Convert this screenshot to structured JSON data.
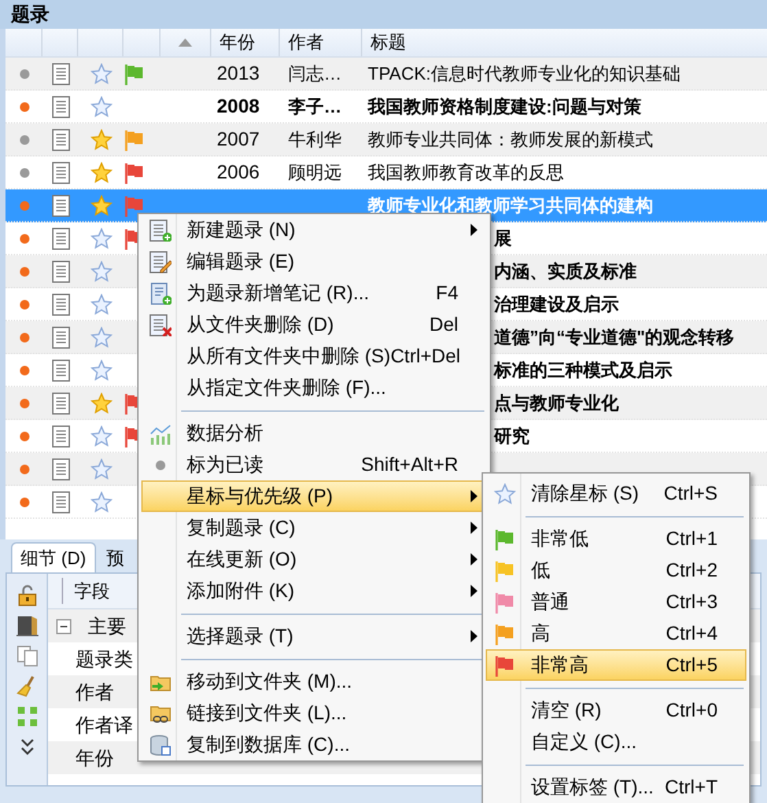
{
  "panel_title": "题录",
  "columns": [
    {
      "label": "年份"
    },
    {
      "label": "作者"
    },
    {
      "label": "标题"
    }
  ],
  "rows": [
    {
      "read": true,
      "starred": false,
      "color": "#5cb82e",
      "selected": false,
      "kind": "full",
      "year": "2013",
      "author": "闫志…",
      "title": "TPACK:信息时代教师专业化的知识基础"
    },
    {
      "read": false,
      "starred": false,
      "selected": false,
      "kind": "full",
      "year": "2008",
      "author": "李子…",
      "title": "我国教师资格制度建设:问题与对策"
    },
    {
      "read": true,
      "starred": true,
      "color": "#f4a020",
      "selected": false,
      "kind": "full",
      "year": "2007",
      "author": "牛利华",
      "title": "教师专业共同体：教师发展的新模式"
    },
    {
      "read": true,
      "starred": true,
      "color": "#e8463a",
      "selected": false,
      "kind": "full",
      "year": "2006",
      "author": "顾明远",
      "title": "我国教师教育改革的反思"
    },
    {
      "read": false,
      "starred": true,
      "color": "#e8463a",
      "selected": true,
      "kind": "full",
      "title": "教师专业化和教师学习共同体的建构"
    },
    {
      "read": false,
      "starred": false,
      "color": "#e8463a",
      "selected": false,
      "kind": "covered",
      "title": "展"
    },
    {
      "read": false,
      "starred": false,
      "selected": false,
      "kind": "covered",
      "title": "内涵、实质及标准"
    },
    {
      "read": false,
      "starred": false,
      "selected": false,
      "kind": "covered",
      "title": "治理建设及启示"
    },
    {
      "read": false,
      "starred": false,
      "selected": false,
      "kind": "covered",
      "title": "道德”向“专业道德\"的观念转移"
    },
    {
      "read": false,
      "starred": false,
      "selected": false,
      "kind": "covered",
      "title": "标准的三种模式及启示"
    },
    {
      "read": false,
      "starred": true,
      "color": "#e8463a",
      "selected": false,
      "kind": "covered",
      "title": "点与教师专业化"
    },
    {
      "read": false,
      "starred": false,
      "color": "#e8463a",
      "selected": false,
      "kind": "covered",
      "title": "研究"
    },
    {
      "read": false,
      "starred": false,
      "selected": false,
      "kind": "covered"
    },
    {
      "read": false,
      "starred": false,
      "selected": false,
      "kind": "covered"
    }
  ],
  "bottom_tabs": [
    {
      "label": "细节 (D)",
      "selected": true
    },
    {
      "label": "预",
      "selected": false
    }
  ],
  "fields": {
    "column": "字段",
    "rows": [
      {
        "kind": "group",
        "label": "主要",
        "expanded": true
      },
      {
        "kind": "field",
        "label": "题录类"
      },
      {
        "kind": "field",
        "label": "作者"
      },
      {
        "kind": "field",
        "label": "作者译"
      },
      {
        "kind": "field",
        "label": "年份"
      }
    ]
  },
  "context_menu": [
    {
      "kind": "item",
      "label": "新建题录 (N)",
      "submenu": true,
      "selected": false
    },
    {
      "kind": "item",
      "label": "编辑题录 (E)",
      "selected": false
    },
    {
      "kind": "item",
      "label": "为题录新增笔记 (R)...",
      "shortcut": "F4",
      "selected": false
    },
    {
      "kind": "item",
      "label": "从文件夹删除 (D)",
      "shortcut": "Del",
      "selected": false
    },
    {
      "kind": "item",
      "label": "从所有文件夹中删除 (S)",
      "shortcut": "Ctrl+Del",
      "selected": false
    },
    {
      "kind": "item",
      "label": "从指定文件夹删除 (F)...",
      "selected": false
    },
    {
      "kind": "separator"
    },
    {
      "kind": "item",
      "label": "数据分析",
      "selected": false
    },
    {
      "kind": "item",
      "label": "标为已读",
      "shortcut": "Shift+Alt+R",
      "selected": false
    },
    {
      "kind": "item",
      "label": "星标与优先级 (P)",
      "submenu": true,
      "selected": true
    },
    {
      "kind": "item",
      "label": "复制题录 (C)",
      "submenu": true,
      "selected": false
    },
    {
      "kind": "item",
      "label": "在线更新 (O)",
      "submenu": true,
      "selected": false
    },
    {
      "kind": "item",
      "label": "添加附件 (K)",
      "submenu": true,
      "selected": false
    },
    {
      "kind": "separator"
    },
    {
      "kind": "item",
      "label": "选择题录 (T)",
      "submenu": true,
      "selected": false
    },
    {
      "kind": "separator"
    },
    {
      "kind": "item",
      "label": "移动到文件夹 (M)...",
      "selected": false
    },
    {
      "kind": "item",
      "label": "链接到文件夹 (L)...",
      "selected": false
    },
    {
      "kind": "item",
      "label": "复制到数据库 (C)...",
      "selected": false
    }
  ],
  "submenu": [
    {
      "kind": "star",
      "label": "清除星标 (S)",
      "shortcut": "Ctrl+S",
      "selected": false
    },
    {
      "kind": "separator"
    },
    {
      "kind": "flag",
      "label": "非常低",
      "shortcut": "Ctrl+1",
      "color": "#5cb82e",
      "selected": false
    },
    {
      "kind": "flag",
      "label": "低",
      "shortcut": "Ctrl+2",
      "color": "#f7c325",
      "selected": false
    },
    {
      "kind": "flag",
      "label": "普通",
      "shortcut": "Ctrl+3",
      "color": "#f08aa8",
      "selected": false
    },
    {
      "kind": "flag",
      "label": "高",
      "shortcut": "Ctrl+4",
      "color": "#f4a020",
      "selected": false
    },
    {
      "kind": "flag",
      "label": "非常高",
      "shortcut": "Ctrl+5",
      "color": "#e8463a",
      "selected": true
    },
    {
      "kind": "separator"
    },
    {
      "kind": "plain",
      "label": "清空 (R)",
      "shortcut": "Ctrl+0",
      "selected": false
    },
    {
      "kind": "plain",
      "label": "自定义 (C)...",
      "selected": false
    },
    {
      "kind": "separator"
    },
    {
      "kind": "plain",
      "label": "设置标签 (T)...",
      "shortcut": "Ctrl+T",
      "selected": false
    }
  ]
}
